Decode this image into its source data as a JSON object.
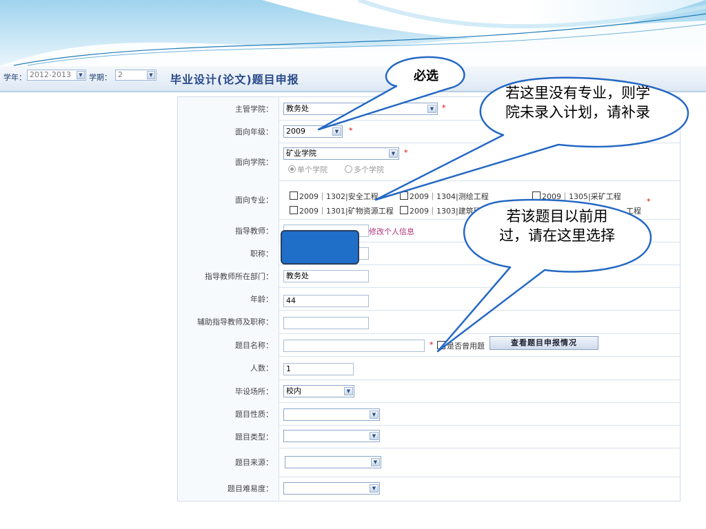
{
  "header": {
    "year_label": "学年：",
    "year_value": "2012-2013",
    "term_label": "学期：",
    "term_value": "2",
    "title": "毕业设计(论文)题目申报"
  },
  "form": {
    "rows": [
      {
        "label": "主管学院：",
        "value": "教务处"
      },
      {
        "label": "面向年级：",
        "value": "2009"
      },
      {
        "label": "面向学院：",
        "value": "矿业学院",
        "radio_single": "单个学院",
        "radio_multi": "多个学院"
      },
      {
        "label": "面向专业：",
        "majors": [
          "2009｜1302|安全工程",
          "2009｜1304|测绘工程",
          "2009｜1305|采矿工程",
          "2009｜1301|矿物资源工程",
          "2009｜1303|建筑环境",
          "工程"
        ]
      },
      {
        "label": "指导教师：",
        "link": "修改个人信息"
      },
      {
        "label": "职称：",
        "value": ""
      },
      {
        "label": "指导教师所在部门：",
        "value": "教务处"
      },
      {
        "label": "年龄：",
        "value": "44"
      },
      {
        "label": "辅助指导教师及职称：",
        "value": ""
      },
      {
        "label": "题目名称：",
        "value": "",
        "checkbox_label": "是否曾用题",
        "button": "查看题目申报情况"
      },
      {
        "label": "人数：",
        "value": "1"
      },
      {
        "label": "毕设场所：",
        "value": "校内"
      },
      {
        "label": "题目性质：",
        "value": ""
      },
      {
        "label": "题目类型：",
        "value": ""
      },
      {
        "label": "题目来源：",
        "value": ""
      },
      {
        "label": "题目难易度：",
        "value": ""
      }
    ],
    "required_mark": "*"
  },
  "callouts": {
    "must_select": "必选",
    "no_major": "若这里没有专业，则学院未录入计划，请补录",
    "used_before": "若该题目以前用过，请在这里选择"
  },
  "colors": {
    "title": "#2a4a8a",
    "callout_border": "#2468c4",
    "redaction": "#1f6fc8",
    "required": "#e00000",
    "link": "#b0307a"
  }
}
